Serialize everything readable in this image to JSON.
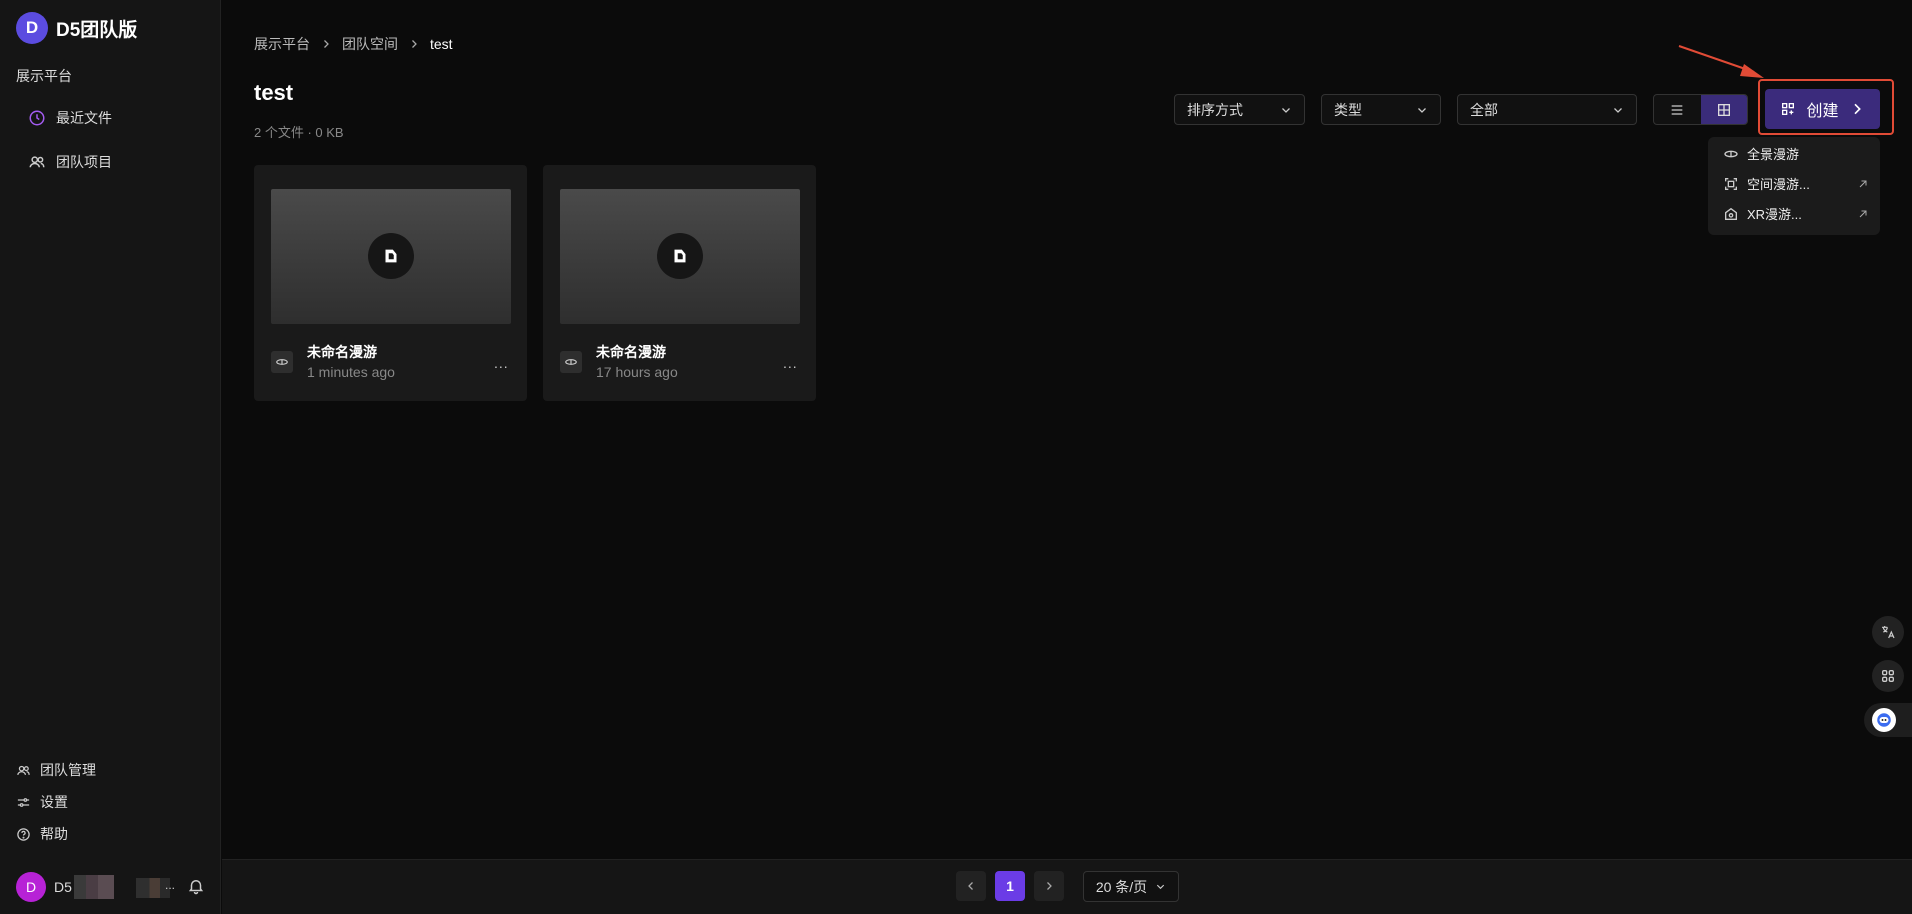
{
  "app": {
    "brand_letter": "D",
    "brand_name": "D5团队版",
    "accent": "#5b4ce0"
  },
  "sidebar": {
    "section": "展示平台",
    "items": [
      {
        "label": "最近文件",
        "icon": "clock-icon"
      },
      {
        "label": "团队项目",
        "icon": "users-icon"
      }
    ],
    "bottom": [
      {
        "label": "团队管理",
        "icon": "users-icon"
      },
      {
        "label": "设置",
        "icon": "sliders-icon"
      },
      {
        "label": "帮助",
        "icon": "help-circle-icon"
      }
    ],
    "user": {
      "initial": "D",
      "name": "D5",
      "more": "..."
    }
  },
  "breadcrumb": [
    "展示平台",
    "团队空间",
    "test"
  ],
  "page": {
    "title": "test",
    "meta": "2 个文件 · 0 KB"
  },
  "filters": {
    "sort": "排序方式",
    "type": "类型",
    "all": "全部"
  },
  "create": {
    "label": "创建",
    "accent": "#3b2b7c",
    "highlight": "#e14b36"
  },
  "create_menu": [
    {
      "label": "全景漫游",
      "icon": "panorama-icon",
      "external": false
    },
    {
      "label": "空间漫游...",
      "icon": "space-scan-icon",
      "external": true
    },
    {
      "label": "XR漫游...",
      "icon": "xr-home-icon",
      "external": true
    }
  ],
  "files": [
    {
      "name": "未命名漫游",
      "time": "1 minutes ago",
      "more": "..."
    },
    {
      "name": "未命名漫游",
      "time": "17 hours ago",
      "more": "..."
    }
  ],
  "pagination": {
    "current": "1",
    "per_page": "20 条/页",
    "accent": "#6b3ce6"
  }
}
